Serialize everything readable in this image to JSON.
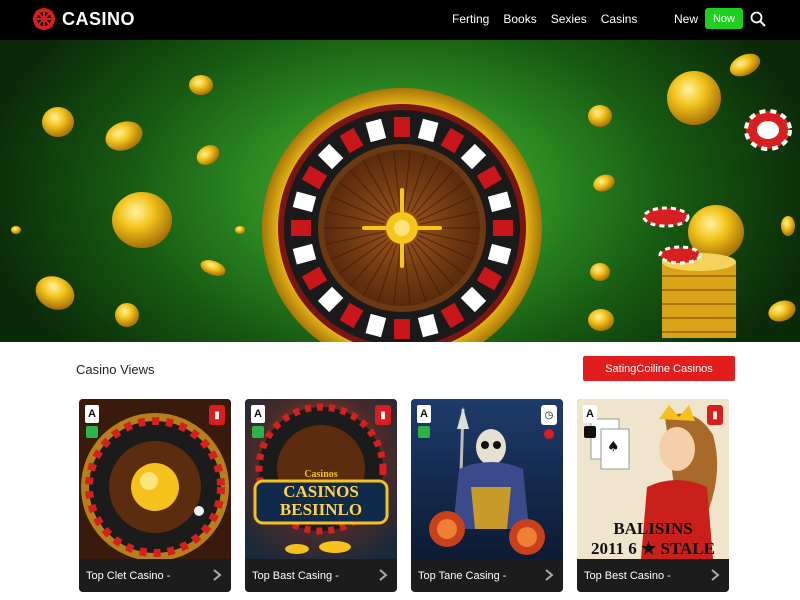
{
  "header": {
    "logo_text": "CASINO",
    "nav": [
      "Ferting",
      "Books",
      "Sexies",
      "Casins"
    ],
    "new_label": "New",
    "cta_label": "Now"
  },
  "section": {
    "title": "Casino Views",
    "button_label": "SatingCoiline Casinos"
  },
  "cards": [
    {
      "badge": "A",
      "label": "Top Clet Casino -",
      "art_text": ""
    },
    {
      "badge": "A",
      "label": "Top Bast Casing -",
      "art_text": "CASINOS BESIINLO",
      "art_top": "Casinos"
    },
    {
      "badge": "A",
      "label": "Top Tane Casing -",
      "art_text": ""
    },
    {
      "badge": "A",
      "label": "Top Best Casino -",
      "art_text": "BALISINS",
      "art_sub": "2011 6 ★ STALE"
    }
  ],
  "colors": {
    "header_bg": "#000000",
    "cta_green": "#1fcf1f",
    "accent_red": "#e21d1d",
    "hero_green": "#2d8a22",
    "gold": "#f2c31b"
  },
  "icons": {
    "logo": "roulette-wheel-icon",
    "search": "search-icon",
    "chevron": "chevron-right-icon"
  }
}
